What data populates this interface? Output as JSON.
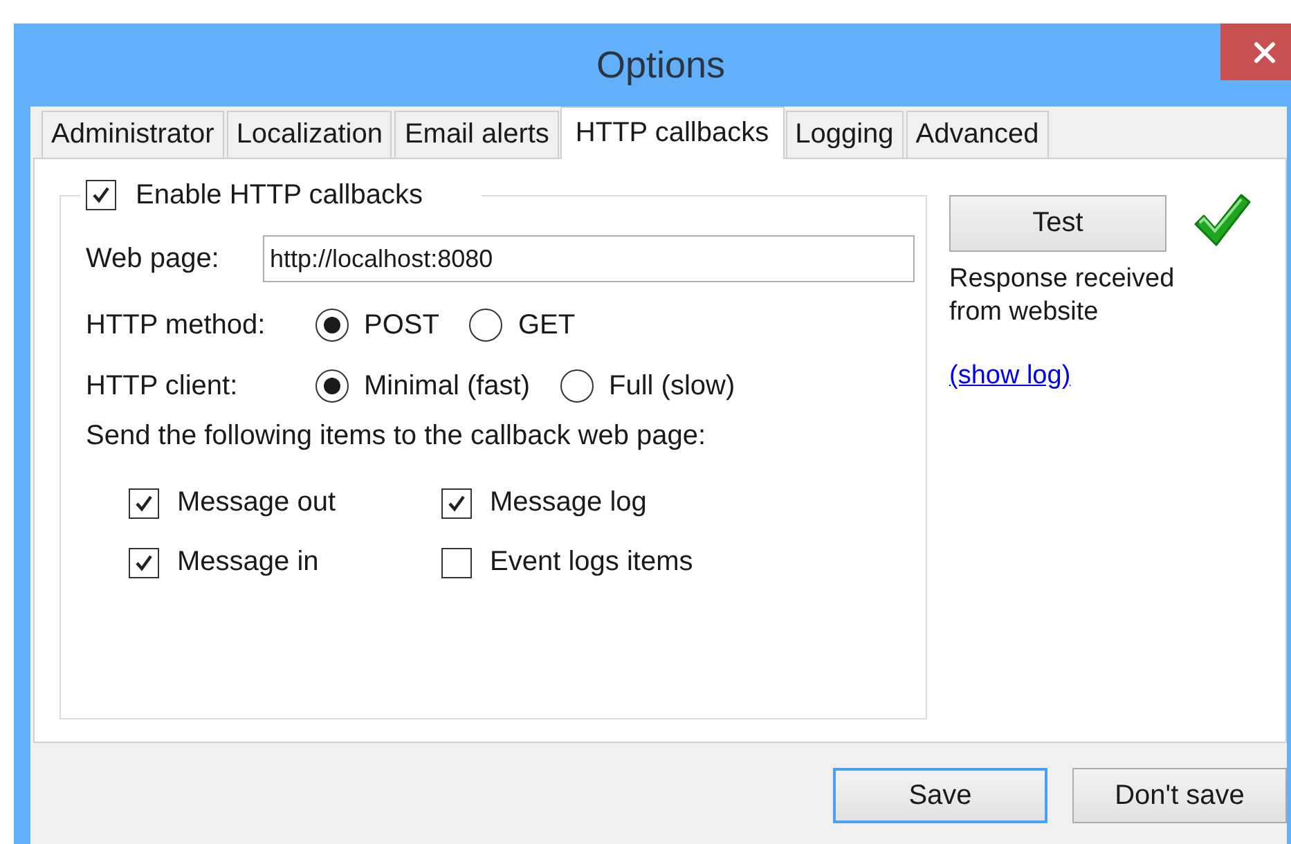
{
  "window": {
    "title": "Options"
  },
  "tabs": [
    {
      "label": "Administrator",
      "selected": false
    },
    {
      "label": "Localization",
      "selected": false
    },
    {
      "label": "Email alerts",
      "selected": false
    },
    {
      "label": "HTTP callbacks",
      "selected": true
    },
    {
      "label": "Logging",
      "selected": false
    },
    {
      "label": "Advanced",
      "selected": false
    }
  ],
  "group": {
    "enable": {
      "label": "Enable HTTP callbacks",
      "checked": true
    },
    "web_page": {
      "label": "Web page:",
      "value": "http://localhost:8080"
    },
    "radio_rows": [
      {
        "label": "HTTP method:",
        "options": [
          {
            "label": "POST",
            "selected": true
          },
          {
            "label": "GET",
            "selected": false
          }
        ]
      },
      {
        "label": "HTTP client:",
        "options": [
          {
            "label": "Minimal (fast)",
            "selected": true
          },
          {
            "label": "Full (slow)",
            "selected": false
          }
        ]
      }
    ],
    "items_label": "Send the following items to the callback web page:",
    "items": [
      {
        "label": "Message out",
        "checked": true
      },
      {
        "label": "Message log",
        "checked": true
      },
      {
        "label": "Message in",
        "checked": true
      },
      {
        "label": "Event logs items",
        "checked": false
      }
    ]
  },
  "test": {
    "button": "Test",
    "success": true,
    "message": "Response received from website",
    "link": "(show log)"
  },
  "buttons": [
    {
      "label": "Save",
      "default": true
    },
    {
      "label": "Don't save",
      "default": false
    }
  ]
}
